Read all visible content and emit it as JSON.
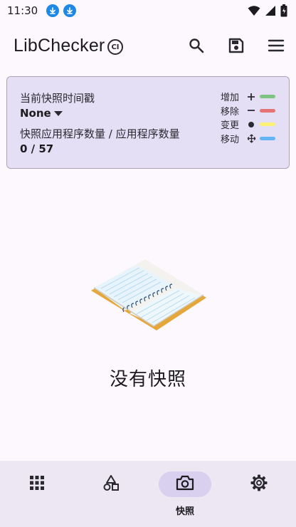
{
  "status_bar": {
    "time": "11:30",
    "icons": [
      "download-icon",
      "download-icon",
      "wifi-icon",
      "signal-icon",
      "battery-icon"
    ]
  },
  "app_bar": {
    "title": "LibChecker",
    "badge": "CI",
    "actions": [
      "search-icon",
      "save-icon",
      "menu-icon"
    ]
  },
  "snapshot": {
    "timestamp_label": "当前快照时间戳",
    "timestamp_value": "None",
    "count_label": "快照应用程序数量 / 应用程序数量",
    "count_value": "0 / 57",
    "legend": [
      {
        "label": "增加",
        "symbol": "+",
        "color": "#7cc47f"
      },
      {
        "label": "移除",
        "symbol": "−",
        "color": "#e57373"
      },
      {
        "label": "变更",
        "symbol": "●",
        "color": "#fff176"
      },
      {
        "label": "移动",
        "symbol": "✥",
        "color": "#64b5f6"
      }
    ]
  },
  "empty_state": {
    "text": "没有快照",
    "illustration": "open-notebook-illustration"
  },
  "bottom_nav": {
    "items": [
      {
        "icon": "apps-grid-icon",
        "label": ""
      },
      {
        "icon": "shapes-icon",
        "label": ""
      },
      {
        "icon": "camera-icon",
        "label": "快照",
        "active": true
      },
      {
        "icon": "settings-gear-icon",
        "label": ""
      }
    ]
  },
  "colors": {
    "card_bg": "#e4dff5",
    "nav_bg": "#ede7f4",
    "nav_active_pill": "#d8d0ee",
    "status_download": "#1e88e5"
  }
}
